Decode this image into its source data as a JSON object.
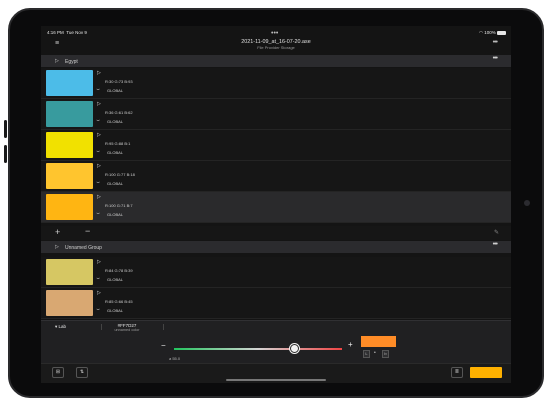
{
  "status_bar": {
    "time": "4:16 PM",
    "date": "Tue Nov 9",
    "battery": "100%"
  },
  "header": {
    "title": "2021-11-09_at_16-07-20.ase",
    "subtitle": "File Provider Storage",
    "top_dots": "•••",
    "more": "•••"
  },
  "groups": [
    {
      "name": "Egypt",
      "colors": [
        {
          "rgb": "R:30  G:73  B:93",
          "scope": "GLOBAL",
          "hex": "#4cbce8",
          "selected": false
        },
        {
          "rgb": "R:36  G:61  B:62",
          "scope": "GLOBAL",
          "hex": "#389b9e",
          "selected": false
        },
        {
          "rgb": "R:95  G:88  B:1",
          "scope": "GLOBAL",
          "hex": "#f1e100",
          "selected": false
        },
        {
          "rgb": "R:100  G:77  B:18",
          "scope": "GLOBAL",
          "hex": "#ffc52e",
          "selected": false
        },
        {
          "rgb": "R:100  G:71  B:7",
          "scope": "GLOBAL",
          "hex": "#ffb512",
          "selected": true
        }
      ]
    },
    {
      "name": "Unnamed Group",
      "colors": [
        {
          "rgb": "R:84  G:78  B:39",
          "scope": "GLOBAL",
          "hex": "#d6c763",
          "selected": false
        },
        {
          "rgb": "R:85  G:66  B:45",
          "scope": "GLOBAL",
          "hex": "#d9a872",
          "selected": false
        }
      ]
    }
  ],
  "toolbar": {
    "add": "+",
    "remove": "−"
  },
  "editor": {
    "mode": "▾ Lab",
    "hex": "#FF7D27",
    "color_name": "unnamed color",
    "minus": "−",
    "plus": "+",
    "slider_label": "a  55.0",
    "slider_value": 55,
    "slider_range": [
      -128,
      127
    ],
    "preview_color": "#ff8c27",
    "box_left": "L",
    "box_right": "b"
  },
  "colors": {
    "accent": "#ffb100",
    "background": "#141414",
    "group_header": "#2b2b2e"
  }
}
